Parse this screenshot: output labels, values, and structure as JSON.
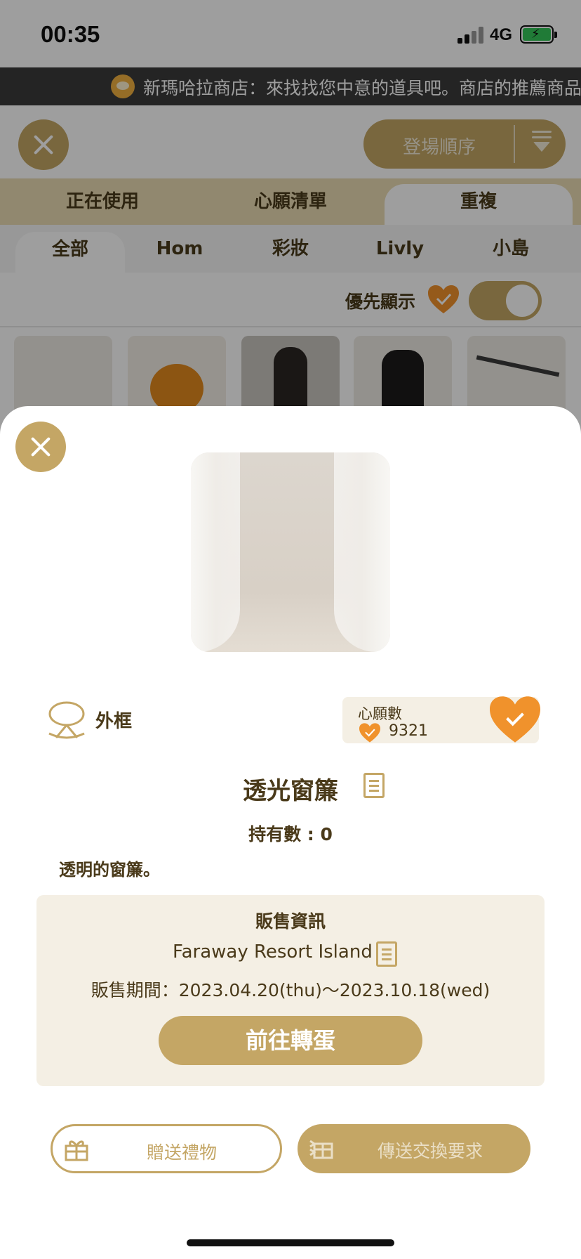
{
  "status_bar": {
    "time": "00:35",
    "network": "4G"
  },
  "ticker": {
    "text": "新瑪哈拉商店：來找找您中意的道具吧。商店的推薦商品"
  },
  "header": {
    "sort_label": "登場順序"
  },
  "tabs_primary": [
    "正在使用",
    "心願清單",
    "重複"
  ],
  "tabs_secondary": [
    "全部",
    "Hom",
    "彩妝",
    "Livly",
    "小島"
  ],
  "filter": {
    "label": "優先顯示",
    "toggle_on": true
  },
  "item_modal": {
    "category": "外框",
    "wish": {
      "title": "心願數",
      "count": "9321"
    },
    "name": "透光窗簾",
    "owned": "持有數 : 0",
    "description": "透明的窗簾。",
    "sale": {
      "title": "販售資訊",
      "place": "Faraway Resort Island",
      "period": "販售期間：2023.04.20(thu)〜2023.10.18(wed)",
      "button": "前往轉蛋"
    },
    "gift_button": "贈送禮物",
    "trade_button": "傳送交換要求"
  },
  "colors": {
    "accent_gold": "#c4a665",
    "heart_orange": "#f0922c",
    "panel_beige": "#f4efe4"
  },
  "icons": [
    "close-icon",
    "sort-icon",
    "heart-check-icon",
    "frame-category-icon",
    "document-icon",
    "gift-icon",
    "trade-icon"
  ]
}
